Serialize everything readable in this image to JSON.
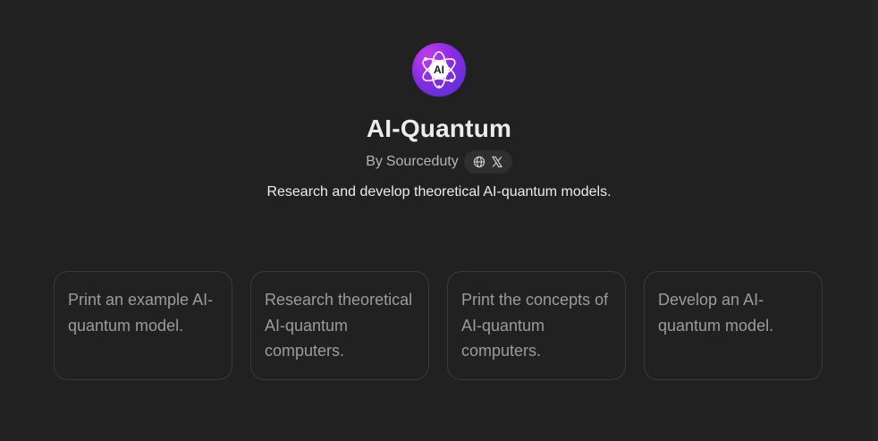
{
  "gpt": {
    "logo_text": "AI",
    "title": "AI-Quantum",
    "author_prefix": "By",
    "author": "Sourceduty",
    "description": "Research and develop theoretical AI-quantum models.",
    "links": [
      {
        "icon": "globe-icon"
      },
      {
        "icon": "x-icon"
      }
    ]
  },
  "prompts": [
    {
      "text": "Print an example AI-quantum model."
    },
    {
      "text": "Research theoretical AI-quantum computers."
    },
    {
      "text": "Print the concepts of AI-quantum computers."
    },
    {
      "text": "Develop an AI-quantum model."
    }
  ],
  "colors": {
    "background": "#212121",
    "logo_gradient_start": "#c03cf0",
    "logo_gradient_end": "#4b33d6",
    "card_border": "#3a3a3a"
  }
}
